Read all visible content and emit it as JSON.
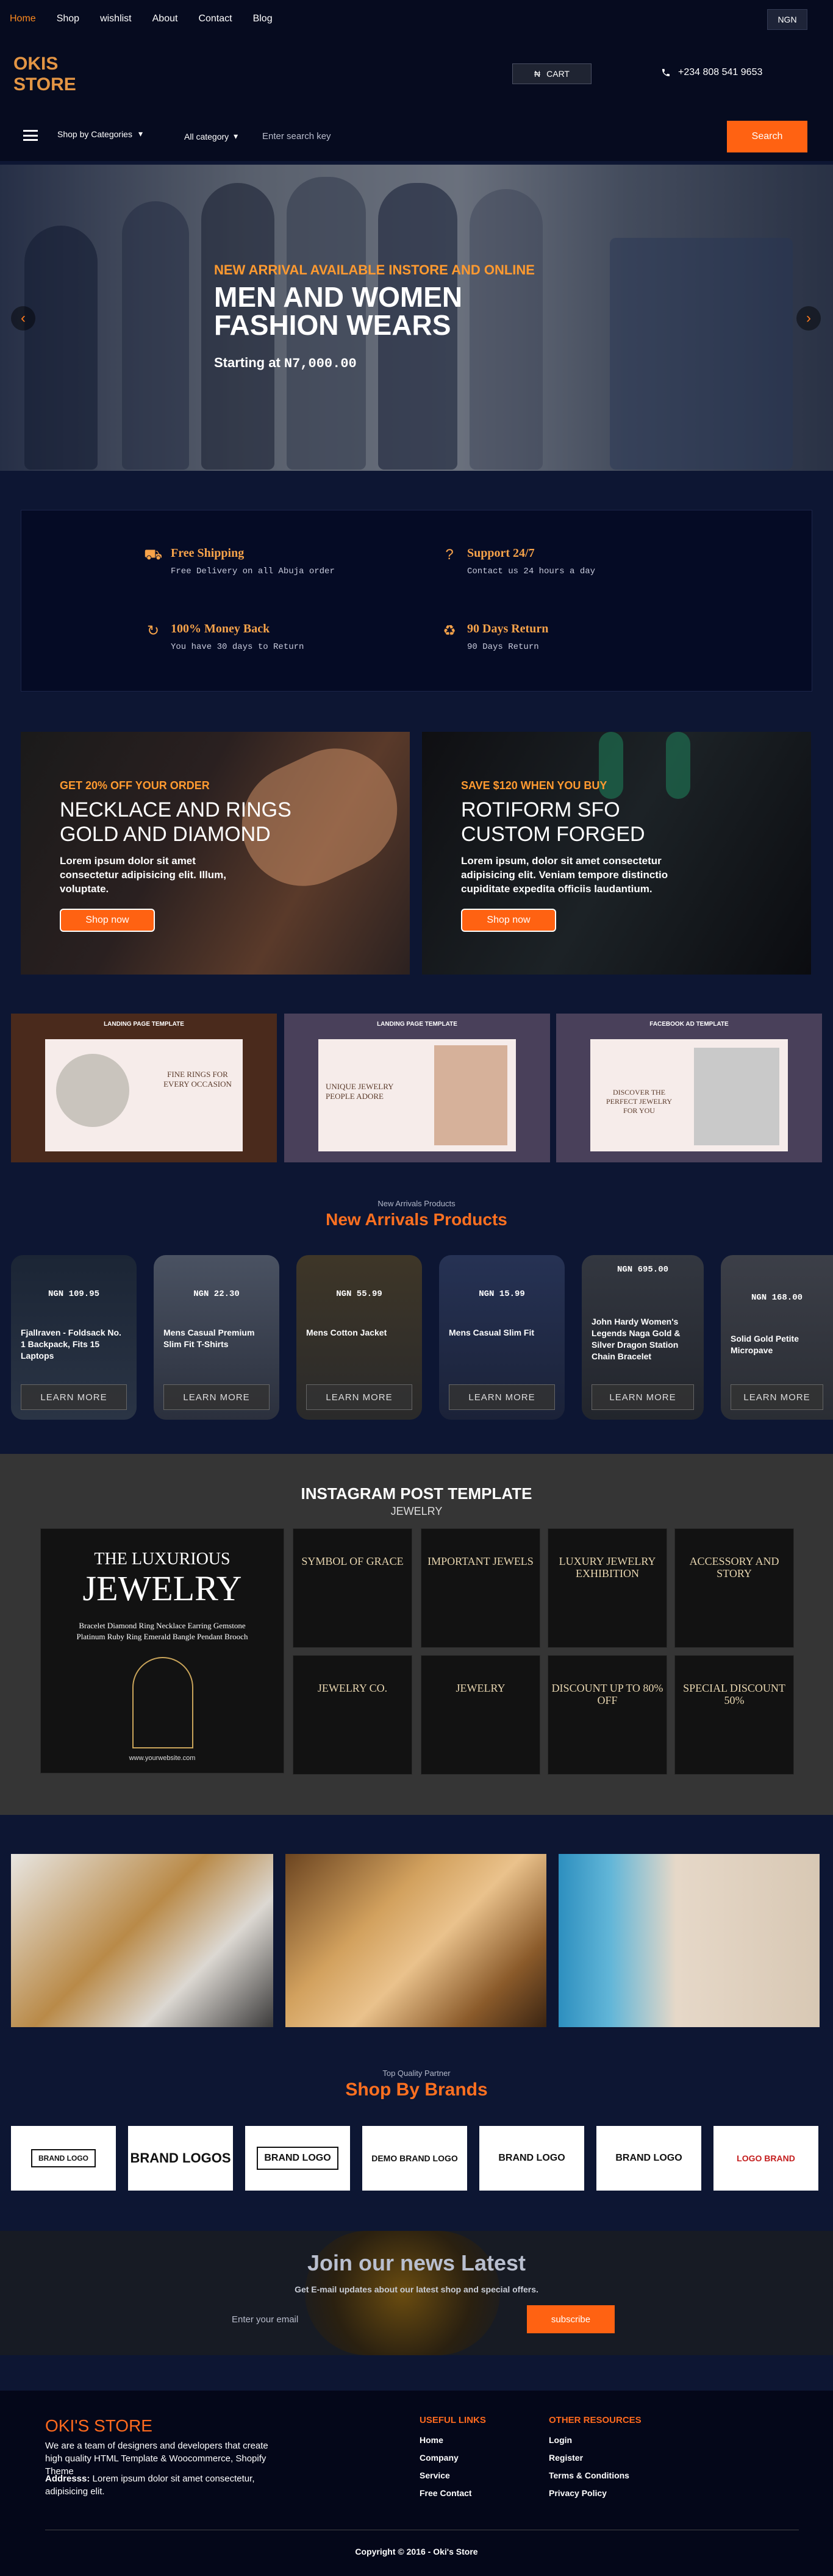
{
  "nav": {
    "items": [
      "Home",
      "Shop",
      "wishlist",
      "About",
      "Contact",
      "Blog"
    ],
    "currency": "NGN"
  },
  "brand": {
    "line1": "OKIS",
    "line2": "STORE"
  },
  "header": {
    "cart_label": "CART",
    "cart_symbol": "₦",
    "phone": "+234 808 541 9653"
  },
  "search": {
    "categories_label": "Shop by Categories",
    "all_category": "All category",
    "placeholder": "Enter search key",
    "button": "Search"
  },
  "hero": {
    "subtitle": "NEW ARRIVAL AVAILABLE INSTORE AND ONLINE",
    "title_line1": "MEN AND WOMEN",
    "title_line2": "FASHION WEARS",
    "price_label": "Starting at ",
    "price": "N7,000.00"
  },
  "features": [
    {
      "title": "Free Shipping",
      "desc": "Free Delivery on all Abuja order",
      "icon": "truck-icon"
    },
    {
      "title": "Support 24/7",
      "desc": "Contact us 24 hours a day",
      "icon": "support-icon"
    },
    {
      "title": "100% Money Back",
      "desc": "You have 30 days to Return",
      "icon": "refresh-icon"
    },
    {
      "title": "90 Days Return",
      "desc": "90 Days Return",
      "icon": "recycle-icon"
    }
  ],
  "promos": [
    {
      "sub": "GET 20% OFF YOUR ORDER",
      "title1": "NECKLACE AND RINGS",
      "title2": "GOLD AND DIAMOND",
      "text": "Lorem ipsum dolor sit amet consectetur adipisicing elit. Illum, voluptate.",
      "button": "Shop now"
    },
    {
      "sub": "SAVE $120 WHEN YOU BUY",
      "title1": "ROTIFORM SFO",
      "title2": "CUSTOM FORGED",
      "text": "Lorem ipsum, dolor sit amet consectetur adipisicing elit. Veniam tempore distinctio cupiditate expedita officiis laudantium.",
      "button": "Shop now"
    }
  ],
  "templates": [
    {
      "label": "LANDING PAGE TEMPLATE",
      "heading": "FINE RINGS FOR EVERY OCCASION"
    },
    {
      "label": "LANDING PAGE TEMPLATE",
      "heading": "UNIQUE JEWELRY PEOPLE ADORE"
    },
    {
      "label": "FACEBOOK AD TEMPLATE",
      "heading": "DISCOVER THE PERFECT JEWELRY FOR YOU"
    }
  ],
  "arrivals": {
    "sub": "New Arrivals Products",
    "title": "New Arrivals Products",
    "button": "LEARN MORE",
    "products": [
      {
        "price": "NGN 109.95",
        "name": "Fjallraven - Foldsack No. 1 Backpack, Fits 15 Laptops"
      },
      {
        "price": "NGN 22.30",
        "name": "Mens Casual Premium Slim Fit T-Shirts"
      },
      {
        "price": "NGN 55.99",
        "name": "Mens Cotton Jacket"
      },
      {
        "price": "NGN 15.99",
        "name": "Mens Casual Slim Fit"
      },
      {
        "price": "NGN 695.00",
        "name": "John Hardy Women's Legends Naga Gold & Silver Dragon Station Chain Bracelet"
      },
      {
        "price": "NGN 168.00",
        "name": "Solid Gold Petite Micropave"
      }
    ]
  },
  "instagram": {
    "title": "INSTAGRAM POST TEMPLATE",
    "sub": "JEWELRY",
    "feature": {
      "line1": "THE LUXURIOUS",
      "line2": "JEWELRY",
      "items": "Bracelet  Diamond Ring  Necklace  Earring  Gemstone  Platinum  Ruby  Ring  Emerald  Bangle  Pendant  Brooch",
      "site": "www.yourwebsite.com"
    },
    "posts": [
      "SYMBOL OF GRACE",
      "IMPORTANT JEWELS",
      "LUXURY JEWELRY EXHIBITION",
      "ACCESSORY AND STORY",
      "JEWELRY CO.",
      "JEWELRY",
      "DISCOUNT UP TO 80% OFF",
      "SPECIAL DISCOUNT 50%"
    ]
  },
  "partners": {
    "sub": "Top Quality Partner",
    "title": "Shop By Brands",
    "brands": [
      "BRAND LOGO",
      "BRAND LOGOS",
      "BRAND LOGO",
      "DEMO BRAND LOGO",
      "BRAND LOGO",
      "BRAND LOGO",
      "LOGO BRAND"
    ]
  },
  "newsletter": {
    "title": "Join our news Latest",
    "sub": "Get E-mail updates about our latest shop and special offers.",
    "placeholder": "Enter your email",
    "button": "subscribe"
  },
  "footer": {
    "title": "OKI'S STORE",
    "text": "We are a team of designers and developers that create high quality HTML Template & Woocommerce, Shopify Theme",
    "address_label": "Addresss:",
    "address": "Lorem ipsum dolor sit amet consectetur, adipisicing elit.",
    "useful_title": "USEFUL LINKS",
    "useful": [
      "Home",
      "Company",
      "Service",
      "Free Contact"
    ],
    "other_title": "OTHER RESOURCES",
    "other": [
      "Login",
      "Register",
      "Terms & Conditions",
      "Privacy Policy"
    ],
    "copyright": "Copyright © 2016 - Oki's Store"
  },
  "colors": {
    "accent": "#ff6212",
    "gold": "#f7a34a",
    "navy": "#0d1633"
  }
}
